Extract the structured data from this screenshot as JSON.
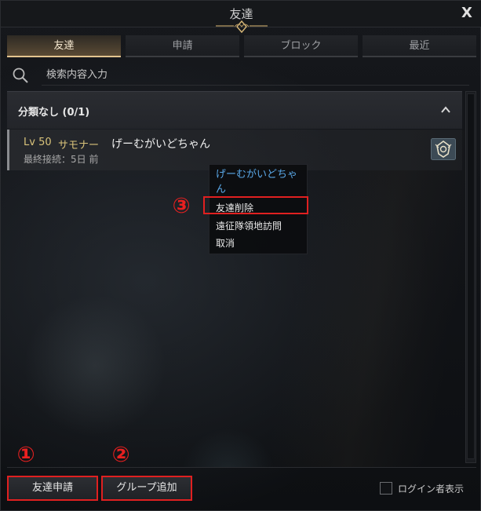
{
  "window": {
    "title": "友達",
    "close_label": "X"
  },
  "tabs": [
    {
      "label": "友達",
      "active": true
    },
    {
      "label": "申請",
      "active": false
    },
    {
      "label": "ブロック",
      "active": false
    },
    {
      "label": "最近",
      "active": false
    }
  ],
  "search": {
    "placeholder": "検索内容入力",
    "value": ""
  },
  "group": {
    "title": "分類なし (0/1)",
    "collapse_icon": "chevron-up-icon"
  },
  "friend": {
    "level": "Lv 50",
    "class": "サモナー",
    "name": "げーむがいどちゃん",
    "last_login": "最終接続：5日 前",
    "rank_icon": "guild-crest-icon"
  },
  "context_menu": {
    "title": "げーむがいどちゃん",
    "items": [
      "友達削除",
      "遠征隊領地訪問",
      "取消"
    ]
  },
  "annotations": {
    "one": "①",
    "two": "②",
    "three": "③"
  },
  "footer": {
    "friend_request_label": "友達申請",
    "add_group_label": "グループ追加",
    "login_filter_label": "ログイン者表示",
    "login_filter_checked": false
  },
  "colors": {
    "accent_gold": "#e3c48f",
    "highlight_red": "#e02020",
    "link_blue": "#5aa8e8",
    "level_yellow": "#d8c27a"
  }
}
